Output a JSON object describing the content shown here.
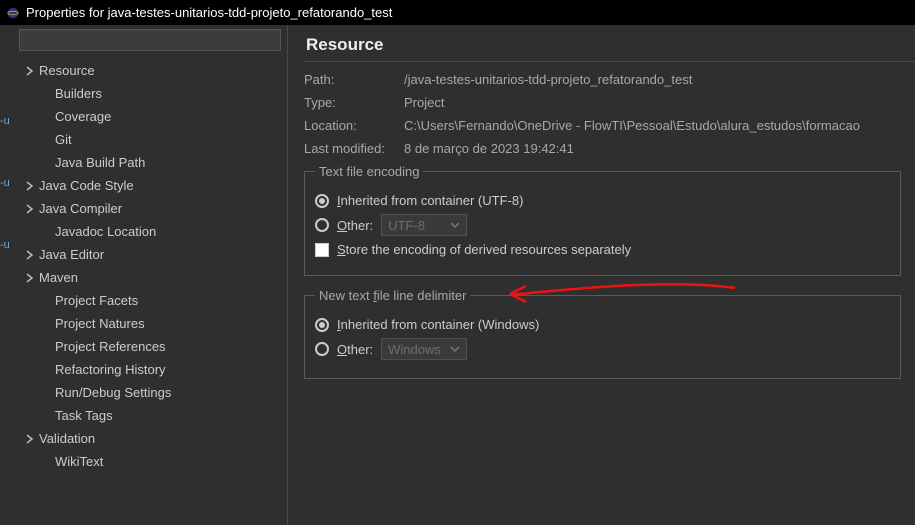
{
  "titlebar": {
    "title": "Properties for java-testes-unitarios-tdd-projeto_refatorando_test"
  },
  "sidebar": {
    "items": [
      {
        "label": "Resource",
        "expandable": true
      },
      {
        "label": "Builders",
        "expandable": false
      },
      {
        "label": "Coverage",
        "expandable": false
      },
      {
        "label": "Git",
        "expandable": false
      },
      {
        "label": "Java Build Path",
        "expandable": false
      },
      {
        "label": "Java Code Style",
        "expandable": true
      },
      {
        "label": "Java Compiler",
        "expandable": true
      },
      {
        "label": "Javadoc Location",
        "expandable": false
      },
      {
        "label": "Java Editor",
        "expandable": true
      },
      {
        "label": "Maven",
        "expandable": true
      },
      {
        "label": "Project Facets",
        "expandable": false
      },
      {
        "label": "Project Natures",
        "expandable": false
      },
      {
        "label": "Project References",
        "expandable": false
      },
      {
        "label": "Refactoring History",
        "expandable": false
      },
      {
        "label": "Run/Debug Settings",
        "expandable": false
      },
      {
        "label": "Task Tags",
        "expandable": false
      },
      {
        "label": "Validation",
        "expandable": true
      },
      {
        "label": "WikiText",
        "expandable": false
      }
    ]
  },
  "main": {
    "heading": "Resource",
    "info": {
      "path_label": "Path:",
      "path_value": "/java-testes-unitarios-tdd-projeto_refatorando_test",
      "type_label": "Type:",
      "type_value": "Project",
      "location_label": "Location:",
      "location_value": "C:\\Users\\Fernando\\OneDrive - FlowTI\\Pessoal\\Estudo\\alura_estudos\\formacao",
      "modified_label": "Last modified:",
      "modified_value": "8 de março de 2023 19:42:41"
    },
    "encoding": {
      "legend": "Text file encoding",
      "inherited_prefix": "I",
      "inherited_rest": "nherited from container (UTF-8)",
      "other_prefix": "O",
      "other_rest": "ther:",
      "other_value": "UTF-8",
      "store_prefix": "S",
      "store_rest": "tore the encoding of derived resources separately"
    },
    "delimiter": {
      "legend_prefix": "New text ",
      "legend_u": "f",
      "legend_rest": "ile line delimiter",
      "inherited_prefix": "I",
      "inherited_rest": "nherited from container (Windows)",
      "other_prefix": "O",
      "other_rest": "ther:",
      "other_value": "Windows"
    }
  }
}
